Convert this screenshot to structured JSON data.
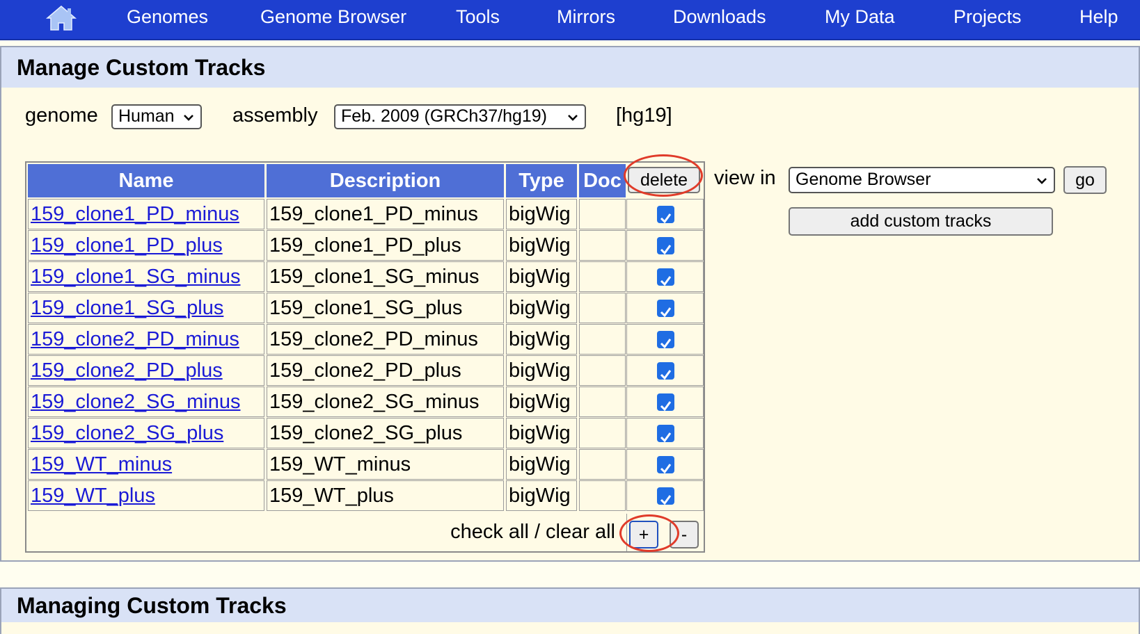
{
  "nav": {
    "home_icon": "home-icon",
    "items": [
      "Genomes",
      "Genome Browser",
      "Tools",
      "Mirrors",
      "Downloads",
      "My Data",
      "Projects",
      "Help"
    ]
  },
  "manage": {
    "title": "Manage Custom Tracks",
    "genome_label": "genome",
    "genome_value": "Human",
    "assembly_label": "assembly",
    "assembly_value": "Feb. 2009 (GRCh37/hg19)",
    "db_tag": "[hg19]",
    "view_in_label": "view in",
    "view_in_value": "Genome Browser",
    "go_label": "go",
    "add_label": "add custom tracks",
    "delete_label": "delete",
    "check_clear_label": "check all / clear all",
    "plus_label": "+",
    "minus_label": "-"
  },
  "table": {
    "headers": [
      "Name",
      "Description",
      "Type",
      "Doc"
    ],
    "rows": [
      {
        "name": "159_clone1_PD_minus",
        "description": "159_clone1_PD_minus",
        "type": "bigWig",
        "doc": "",
        "checked": true
      },
      {
        "name": "159_clone1_PD_plus",
        "description": "159_clone1_PD_plus",
        "type": "bigWig",
        "doc": "",
        "checked": true
      },
      {
        "name": "159_clone1_SG_minus",
        "description": "159_clone1_SG_minus",
        "type": "bigWig",
        "doc": "",
        "checked": true
      },
      {
        "name": "159_clone1_SG_plus",
        "description": "159_clone1_SG_plus",
        "type": "bigWig",
        "doc": "",
        "checked": true
      },
      {
        "name": "159_clone2_PD_minus",
        "description": "159_clone2_PD_minus",
        "type": "bigWig",
        "doc": "",
        "checked": true
      },
      {
        "name": "159_clone2_PD_plus",
        "description": "159_clone2_PD_plus",
        "type": "bigWig",
        "doc": "",
        "checked": true
      },
      {
        "name": "159_clone2_SG_minus",
        "description": "159_clone2_SG_minus",
        "type": "bigWig",
        "doc": "",
        "checked": true
      },
      {
        "name": "159_clone2_SG_plus",
        "description": "159_clone2_SG_plus",
        "type": "bigWig",
        "doc": "",
        "checked": true
      },
      {
        "name": "159_WT_minus",
        "description": "159_WT_minus",
        "type": "bigWig",
        "doc": "",
        "checked": true
      },
      {
        "name": "159_WT_plus",
        "description": "159_WT_plus",
        "type": "bigWig",
        "doc": "",
        "checked": true
      }
    ]
  },
  "managing": {
    "title": "Managing Custom Tracks"
  },
  "colors": {
    "nav_bg": "#1e3fcf",
    "header_bg": "#4f6fd6",
    "panel_header_bg": "#d9e2f6",
    "page_bg": "#fffbe6",
    "link": "#1a1ad6",
    "checkbox": "#1f6de3",
    "annotation_ring": "#e03b2a"
  }
}
